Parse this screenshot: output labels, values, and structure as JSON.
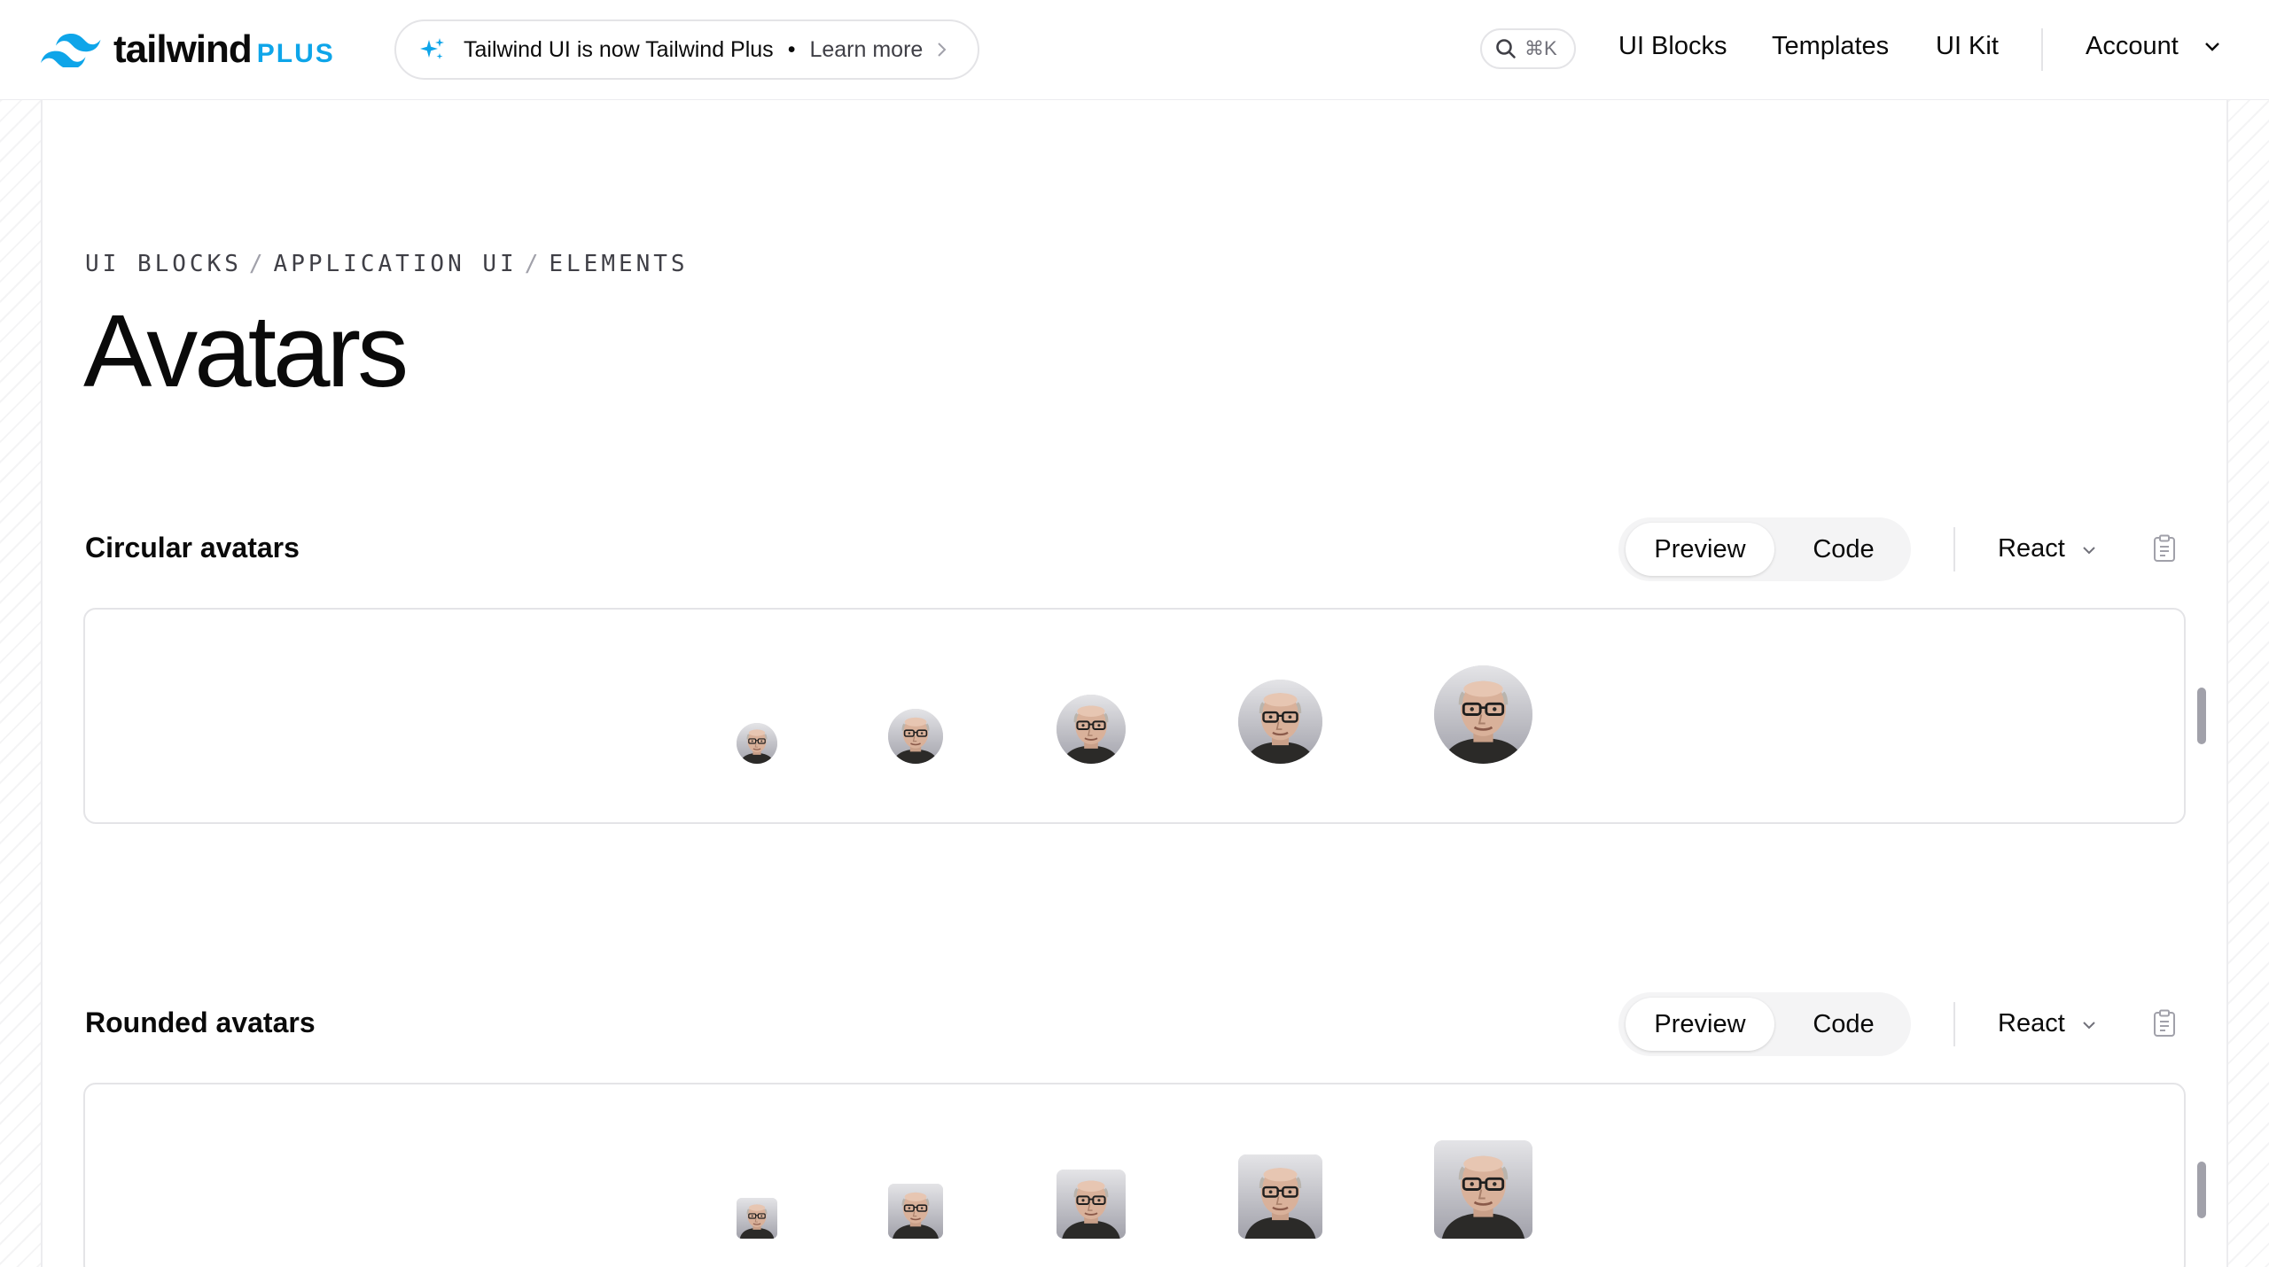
{
  "brand": {
    "word": "tailwind",
    "suffix": "PLUS",
    "accent_color": "#0ea5e9"
  },
  "announcement": {
    "icon": "sparkles-icon",
    "message": "Tailwind UI is now Tailwind Plus",
    "separator": "•",
    "link_label": "Learn more"
  },
  "search": {
    "icon": "search-icon",
    "shortcut": "⌘K"
  },
  "nav": {
    "links": [
      "UI Blocks",
      "Templates",
      "UI Kit"
    ],
    "account_label": "Account"
  },
  "breadcrumb": [
    "UI BLOCKS",
    "APPLICATION UI",
    "ELEMENTS"
  ],
  "page": {
    "title": "Avatars"
  },
  "sections": [
    {
      "title": "Circular avatars",
      "tabs": [
        "Preview",
        "Code"
      ],
      "active_tab": "Preview",
      "framework": "React",
      "avatar_shape": "circle"
    },
    {
      "title": "Rounded avatars",
      "tabs": [
        "Preview",
        "Code"
      ],
      "active_tab": "Preview",
      "framework": "React",
      "avatar_shape": "rounded"
    }
  ]
}
